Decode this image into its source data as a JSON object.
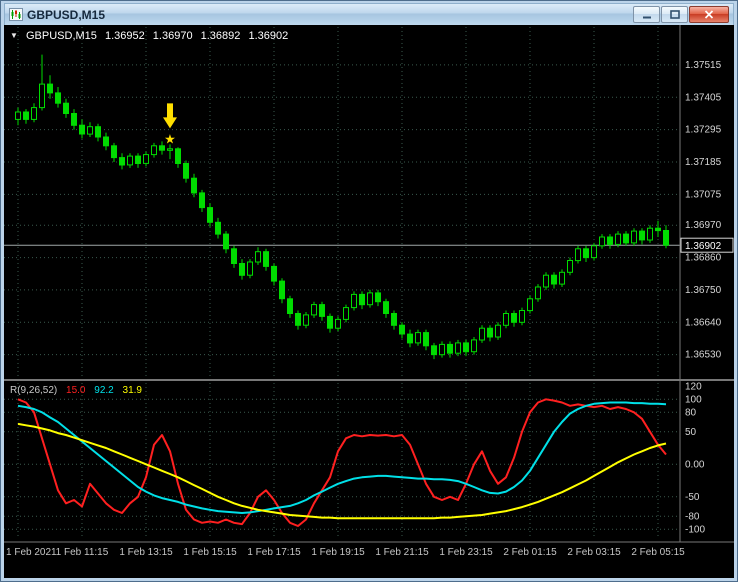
{
  "window": {
    "title": "GBPUSD,M15"
  },
  "header": {
    "collapse_icon": "▼",
    "symbol": "GBPUSD,M15",
    "open": "1.36952",
    "high": "1.36970",
    "low": "1.36892",
    "close": "1.36902"
  },
  "indicator": {
    "name": "R(9,26,52)",
    "value1": "15.0",
    "value2": "92.2",
    "value3": "31.9"
  },
  "colors": {
    "candle_green": "#00dc00",
    "bull_fill": "#000000",
    "grid": "#3a5a4e",
    "axis_text": "#d6d6d6",
    "time_text": "#c6c6c6",
    "current_price_line": "#a0a8a8",
    "divider": "#787878",
    "arrow_yellow": "#ffdf00"
  },
  "chart_data": {
    "type": "candlestick",
    "symbol": "GBPUSD",
    "timeframe": "M15",
    "price_axis": {
      "grid_labels": [
        "1.37515",
        "1.37405",
        "1.37295",
        "1.37185",
        "1.37075",
        "1.36970",
        "1.36860",
        "1.36750",
        "1.36640",
        "1.36530"
      ],
      "current_price": "1.36902",
      "range": [
        1.36454,
        1.37644
      ]
    },
    "time_axis": {
      "labels": [
        "1 Feb 2021",
        "1 Feb 11:15",
        "1 Feb 13:15",
        "1 Feb 15:15",
        "1 Feb 17:15",
        "1 Feb 19:15",
        "1 Feb 21:15",
        "1 Feb 23:15",
        "2 Feb 01:15",
        "2 Feb 03:15",
        "2 Feb 05:15"
      ]
    },
    "candles": [
      [
        1.3733,
        1.3737,
        1.3731,
        1.37355
      ],
      [
        1.37355,
        1.37365,
        1.37315,
        1.3733
      ],
      [
        1.3733,
        1.37385,
        1.3732,
        1.3737
      ],
      [
        1.3737,
        1.3755,
        1.3736,
        1.3745
      ],
      [
        1.3745,
        1.3748,
        1.374,
        1.3742
      ],
      [
        1.3742,
        1.3744,
        1.3737,
        1.37385
      ],
      [
        1.37385,
        1.374,
        1.37335,
        1.3735
      ],
      [
        1.3735,
        1.37365,
        1.37295,
        1.3731
      ],
      [
        1.3731,
        1.3733,
        1.37265,
        1.3728
      ],
      [
        1.3728,
        1.3732,
        1.3727,
        1.37305
      ],
      [
        1.37305,
        1.37315,
        1.37255,
        1.3727
      ],
      [
        1.3727,
        1.37285,
        1.37225,
        1.3724
      ],
      [
        1.3724,
        1.3725,
        1.37185,
        1.372
      ],
      [
        1.372,
        1.37215,
        1.3716,
        1.37175
      ],
      [
        1.37175,
        1.37215,
        1.37165,
        1.37205
      ],
      [
        1.37205,
        1.37215,
        1.37165,
        1.3718
      ],
      [
        1.3718,
        1.3722,
        1.3717,
        1.3721
      ],
      [
        1.3721,
        1.3725,
        1.372,
        1.3724
      ],
      [
        1.3724,
        1.37255,
        1.3721,
        1.37225
      ],
      [
        1.37225,
        1.37245,
        1.37195,
        1.3723
      ],
      [
        1.3723,
        1.37235,
        1.37165,
        1.3718
      ],
      [
        1.3718,
        1.3719,
        1.37115,
        1.3713
      ],
      [
        1.3713,
        1.37145,
        1.37065,
        1.3708
      ],
      [
        1.3708,
        1.3709,
        1.37015,
        1.3703
      ],
      [
        1.3703,
        1.37045,
        1.36965,
        1.3698
      ],
      [
        1.3698,
        1.36995,
        1.36925,
        1.3694
      ],
      [
        1.3694,
        1.3695,
        1.36875,
        1.3689
      ],
      [
        1.3689,
        1.369,
        1.36825,
        1.3684
      ],
      [
        1.3684,
        1.36855,
        1.36785,
        1.368
      ],
      [
        1.368,
        1.36855,
        1.3679,
        1.36845
      ],
      [
        1.36845,
        1.36895,
        1.36835,
        1.3688
      ],
      [
        1.3688,
        1.3689,
        1.36815,
        1.3683
      ],
      [
        1.3683,
        1.3684,
        1.36765,
        1.3678
      ],
      [
        1.3678,
        1.3679,
        1.36705,
        1.3672
      ],
      [
        1.3672,
        1.3673,
        1.36655,
        1.3667
      ],
      [
        1.3667,
        1.3668,
        1.36615,
        1.3663
      ],
      [
        1.3663,
        1.36675,
        1.3662,
        1.36665
      ],
      [
        1.36665,
        1.3671,
        1.36655,
        1.367
      ],
      [
        1.367,
        1.3671,
        1.36645,
        1.3666
      ],
      [
        1.3666,
        1.3667,
        1.36605,
        1.3662
      ],
      [
        1.3662,
        1.3666,
        1.3661,
        1.3665
      ],
      [
        1.3665,
        1.367,
        1.3664,
        1.3669
      ],
      [
        1.3669,
        1.36745,
        1.3668,
        1.36735
      ],
      [
        1.36735,
        1.36745,
        1.36685,
        1.367
      ],
      [
        1.367,
        1.3675,
        1.3669,
        1.3674
      ],
      [
        1.3674,
        1.3675,
        1.36695,
        1.3671
      ],
      [
        1.3671,
        1.3672,
        1.36655,
        1.3667
      ],
      [
        1.3667,
        1.3668,
        1.36615,
        1.3663
      ],
      [
        1.3663,
        1.3664,
        1.36585,
        1.366
      ],
      [
        1.366,
        1.36615,
        1.36555,
        1.3657
      ],
      [
        1.3657,
        1.36615,
        1.3656,
        1.36605
      ],
      [
        1.36605,
        1.36615,
        1.36545,
        1.3656
      ],
      [
        1.3656,
        1.3657,
        1.36515,
        1.3653
      ],
      [
        1.3653,
        1.36575,
        1.3652,
        1.36565
      ],
      [
        1.36565,
        1.36575,
        1.3652,
        1.36535
      ],
      [
        1.36535,
        1.3658,
        1.36525,
        1.3657
      ],
      [
        1.3657,
        1.3658,
        1.36525,
        1.3654
      ],
      [
        1.3654,
        1.3659,
        1.3653,
        1.3658
      ],
      [
        1.3658,
        1.3663,
        1.3657,
        1.3662
      ],
      [
        1.3662,
        1.3663,
        1.36575,
        1.3659
      ],
      [
        1.3659,
        1.3664,
        1.3658,
        1.3663
      ],
      [
        1.3663,
        1.3668,
        1.3662,
        1.3667
      ],
      [
        1.3667,
        1.3668,
        1.36625,
        1.3664
      ],
      [
        1.3664,
        1.3669,
        1.3663,
        1.3668
      ],
      [
        1.3668,
        1.3673,
        1.3667,
        1.3672
      ],
      [
        1.3672,
        1.3677,
        1.3671,
        1.3676
      ],
      [
        1.3676,
        1.3681,
        1.3675,
        1.368
      ],
      [
        1.368,
        1.3681,
        1.36755,
        1.3677
      ],
      [
        1.3677,
        1.3682,
        1.3676,
        1.3681
      ],
      [
        1.3681,
        1.3686,
        1.368,
        1.3685
      ],
      [
        1.3685,
        1.369,
        1.3684,
        1.3689
      ],
      [
        1.3689,
        1.369,
        1.36845,
        1.3686
      ],
      [
        1.3686,
        1.3691,
        1.3685,
        1.369
      ],
      [
        1.369,
        1.3694,
        1.3689,
        1.3693
      ],
      [
        1.3693,
        1.3694,
        1.3689,
        1.36905
      ],
      [
        1.36905,
        1.3695,
        1.36895,
        1.3694
      ],
      [
        1.3694,
        1.3695,
        1.369,
        1.3691
      ],
      [
        1.3691,
        1.3696,
        1.369,
        1.3695
      ],
      [
        1.3695,
        1.3696,
        1.36905,
        1.3692
      ],
      [
        1.3692,
        1.3697,
        1.3691,
        1.3696
      ],
      [
        1.3696,
        1.36985,
        1.3693,
        1.36952
      ],
      [
        1.36952,
        1.3697,
        1.36892,
        1.36902
      ]
    ],
    "annotations": [
      {
        "type": "arrow-down",
        "candle_index": 19,
        "color": "#ffdf00"
      },
      {
        "type": "star",
        "glyph": "★",
        "candle_index": 19,
        "color": "#ffdf00"
      }
    ],
    "indicator_pane": {
      "name": "R(9,26,52)",
      "current_values": [
        15.0,
        92.2,
        31.9
      ],
      "axis_labels": [
        "120",
        "100",
        "80",
        "50",
        "0.00",
        "-50",
        "-80",
        "-100"
      ],
      "levels": [
        100,
        80,
        50,
        0,
        -50,
        -80,
        -100
      ],
      "range": [
        -115,
        125
      ],
      "series": [
        {
          "name": "indicator-line-fast",
          "color": "#ff2020",
          "values": [
            100,
            95,
            80,
            40,
            0,
            -40,
            -60,
            -55,
            -65,
            -30,
            -45,
            -60,
            -70,
            -75,
            -60,
            -50,
            -20,
            30,
            45,
            20,
            -30,
            -70,
            -85,
            -90,
            -88,
            -90,
            -85,
            -90,
            -92,
            -75,
            -50,
            -40,
            -55,
            -75,
            -90,
            -95,
            -85,
            -60,
            -40,
            -20,
            20,
            40,
            45,
            43,
            45,
            44,
            45,
            43,
            45,
            30,
            0,
            -30,
            -50,
            -55,
            -50,
            -55,
            -30,
            0,
            20,
            -10,
            -30,
            -20,
            10,
            50,
            80,
            95,
            100,
            98,
            95,
            90,
            92,
            90,
            88,
            90,
            85,
            88,
            85,
            80,
            70,
            50,
            30,
            15
          ]
        },
        {
          "name": "indicator-line-medium",
          "color": "#00e0e8",
          "values": [
            90,
            88,
            85,
            80,
            72,
            65,
            55,
            45,
            35,
            25,
            15,
            5,
            -5,
            -15,
            -25,
            -35,
            -42,
            -48,
            -52,
            -55,
            -58,
            -62,
            -65,
            -68,
            -70,
            -72,
            -73,
            -74,
            -75,
            -74,
            -72,
            -70,
            -68,
            -66,
            -64,
            -60,
            -55,
            -48,
            -42,
            -36,
            -30,
            -26,
            -22,
            -20,
            -19,
            -18,
            -18,
            -19,
            -20,
            -21,
            -22,
            -22,
            -23,
            -23,
            -24,
            -26,
            -30,
            -35,
            -40,
            -44,
            -45,
            -42,
            -35,
            -25,
            -10,
            10,
            30,
            50,
            65,
            78,
            85,
            90,
            93,
            94,
            95,
            95,
            95,
            94,
            94,
            93,
            93,
            92.2
          ]
        },
        {
          "name": "indicator-line-slow",
          "color": "#ffff00",
          "values": [
            62,
            60,
            58,
            55,
            52,
            48,
            45,
            41,
            37,
            33,
            29,
            25,
            20,
            15,
            10,
            5,
            0,
            -5,
            -10,
            -15,
            -20,
            -26,
            -32,
            -38,
            -44,
            -50,
            -55,
            -60,
            -64,
            -67,
            -70,
            -72,
            -74,
            -76,
            -78,
            -79,
            -80,
            -81,
            -82,
            -82,
            -83,
            -83,
            -83,
            -83,
            -83,
            -83,
            -83,
            -83,
            -83,
            -83,
            -83,
            -83,
            -83,
            -82,
            -82,
            -81,
            -80,
            -79,
            -78,
            -76,
            -74,
            -72,
            -69,
            -66,
            -62,
            -58,
            -53,
            -48,
            -43,
            -37,
            -31,
            -25,
            -18,
            -11,
            -4,
            3,
            9,
            15,
            20,
            25,
            29,
            31.9
          ]
        }
      ]
    }
  }
}
